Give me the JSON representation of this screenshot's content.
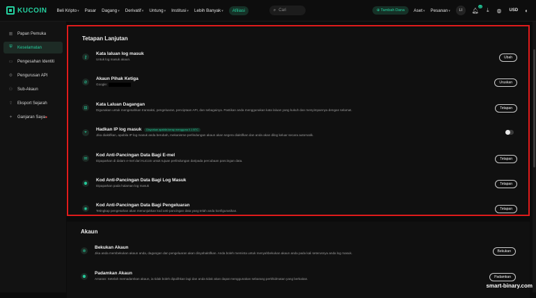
{
  "brand": {
    "name": "KUCOIN"
  },
  "nav": {
    "links": [
      {
        "label": "Beli Kripto",
        "dropdown": true
      },
      {
        "label": "Pasar",
        "dropdown": false
      },
      {
        "label": "Dagang",
        "dropdown": true
      },
      {
        "label": "Derivatif",
        "dropdown": true
      },
      {
        "label": "Untung",
        "dropdown": true
      },
      {
        "label": "Institusi",
        "dropdown": true
      },
      {
        "label": "Lebih Banyak",
        "dropdown": true
      }
    ],
    "afiliasi": "Afiliasi",
    "search_placeholder": "Cari",
    "deposit_label": "Tambah Dana",
    "aset": "Aset",
    "pesanan": "Pesanan",
    "avatar": "LI",
    "notification_count": "12",
    "currency": "USD"
  },
  "sidebar": {
    "items": [
      {
        "label": "Papan Pemuka",
        "icon": "dashboard-icon",
        "active": false
      },
      {
        "label": "Keselamatan",
        "icon": "shield-icon",
        "active": true
      },
      {
        "label": "Pengesahan Identiti",
        "icon": "id-icon",
        "active": false
      },
      {
        "label": "Pengurusan API",
        "icon": "api-icon",
        "active": false
      },
      {
        "label": "Sub-Akaun",
        "icon": "users-icon",
        "active": false
      },
      {
        "label": "Eksport Sejarah",
        "icon": "export-icon",
        "active": false
      },
      {
        "label": "Ganjaran Saya",
        "icon": "gift-icon",
        "active": false
      }
    ]
  },
  "advanced": {
    "title": "Tetapan Lanjutan",
    "rows": [
      {
        "title": "Kata laluan log masuk",
        "desc": "Untuk log masuk akaun.",
        "button": "Ubah",
        "icon": "key-icon"
      },
      {
        "title": "Akaun Pihak Ketiga",
        "desc": "Google:",
        "button": "Uruskan",
        "icon": "link-icon"
      },
      {
        "title": "Kata Laluan Dagangan",
        "desc": "Digunakan untuk mengesahkan transaksi, pengeluaran, penciptaan API, dan sebagainya. Pastikan anda menggunakan kata laluan yang kukuh dan menyimpannya dengan selamat.",
        "button": "Tetapan",
        "icon": "lock-icon"
      },
      {
        "title": "Hadkan IP log masuk",
        "tag": "Disyorkan apabila kerap mengguna 0.1 BTC",
        "desc": "Jika diaktifkan, apabila IP log masuk anda berubah, mekanisme perlindungan akaun akan segera diaktifkan dan anda akan dilog keluar secara automatik.",
        "toggle": "off",
        "icon": "location-icon"
      },
      {
        "title": "Kod Anti-Pancingan Data Bagi E-mel",
        "desc": "Dipaparkan di dalam e-mel dari KuCoin untuk tujuan perlindungan daripada percubaan pancingan data.",
        "button": "Tetapan",
        "icon": "mail-icon"
      },
      {
        "title": "Kod Anti-Pancingan Data Bagi Log Masuk",
        "desc": "Dipaparkan pada halaman log masuk",
        "button": "Tetapan",
        "icon": "login-icon"
      },
      {
        "title": "Kod Anti-Pancingan Data Bagi Pengeluaran",
        "desc": "Tetingkap pengesahan akan menunjukkan kod anti-pancingan data yang telah anda konfigurasikan.",
        "button": "Tetapan",
        "icon": "withdraw-icon"
      }
    ]
  },
  "account": {
    "title": "Akaun",
    "rows": [
      {
        "title": "Bekukan Akaun",
        "desc": "Jika anda membekukan akaun anda, dagangan dan pengeluaran akan dinyahaktifkan. Anda boleh meminta untuk menyahbekukan akaun anda pada kali seterusnya anda log masuk.",
        "button": "Bekukan",
        "icon": "freeze-icon"
      },
      {
        "title": "Padamkan Akaun",
        "desc": "Amaran: Setelah memadamkan akaun, ia tidak boleh dipulihkan lagi dan anda tidak akan dapat menggunakan sebarang perkhidmatan yang berkaitan.",
        "button": "Padamkan",
        "icon": "delete-user-icon"
      }
    ]
  },
  "watermark": "smart-binary.com"
}
